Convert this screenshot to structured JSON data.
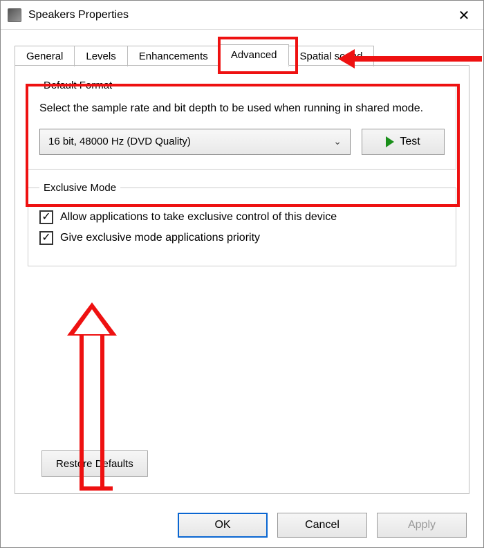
{
  "window": {
    "title": "Speakers Properties"
  },
  "tabs": {
    "general": "General",
    "levels": "Levels",
    "enhancements": "Enhancements",
    "advanced": "Advanced",
    "spatial": "Spatial sound"
  },
  "defaultFormat": {
    "legend": "Default Format",
    "description": "Select the sample rate and bit depth to be used when running in shared mode.",
    "selected": "16 bit, 48000 Hz (DVD Quality)",
    "testLabel": "Test"
  },
  "exclusiveMode": {
    "legend": "Exclusive Mode",
    "opt1": "Allow applications to take exclusive control of this device",
    "opt2": "Give exclusive mode applications priority",
    "opt1_checked": true,
    "opt2_checked": true
  },
  "restoreLabel": "Restore Defaults",
  "footer": {
    "ok": "OK",
    "cancel": "Cancel",
    "apply": "Apply"
  }
}
